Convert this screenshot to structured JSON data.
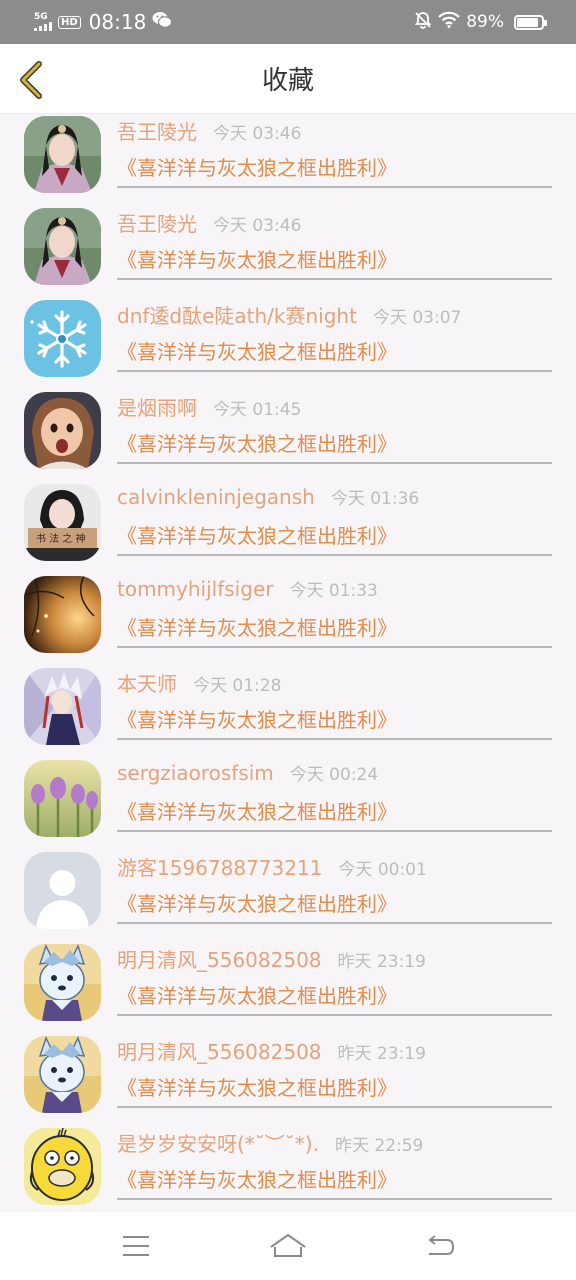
{
  "status_bar": {
    "network": "5G",
    "hd": "HD",
    "time": "08:18",
    "battery": "89%",
    "battery_level": 0.89
  },
  "header": {
    "title": "收藏",
    "back_icon": "chevron-left-icon"
  },
  "colors": {
    "accent": "#e38c4c",
    "name": "#e6a37a",
    "time": "#bdbdbd",
    "back_icon": "#d9b52f"
  },
  "items": [
    {
      "name": "吾王陵光",
      "time": "今天 03:46",
      "title": "《喜洋洋与灰太狼之框出胜利》",
      "avatar": "avatar-costume-man"
    },
    {
      "name": "吾王陵光",
      "time": "今天 03:46",
      "title": "《喜洋洋与灰太狼之框出胜利》",
      "avatar": "avatar-costume-man"
    },
    {
      "name": "dnf逶d酞e陡ath/k赛night",
      "time": "今天 03:07",
      "title": "《喜洋洋与灰太狼之框出胜利》",
      "avatar": "avatar-snowflake"
    },
    {
      "name": "是烟雨啊",
      "time": "今天 01:45",
      "title": "《喜洋洋与灰太狼之框出胜利》",
      "avatar": "avatar-child"
    },
    {
      "name": "calvinkleninjegansh",
      "time": "今天 01:36",
      "title": "《喜洋洋与灰太狼之框出胜利》",
      "avatar": "avatar-woman-sign"
    },
    {
      "name": "tommyhijlfsiger",
      "time": "今天 01:33",
      "title": "《喜洋洋与灰太狼之框出胜利》",
      "avatar": "avatar-sunset"
    },
    {
      "name": "本天师",
      "time": "今天 01:28",
      "title": "《喜洋洋与灰太狼之框出胜利》",
      "avatar": "avatar-anime-master"
    },
    {
      "name": "sergziaorosfsim",
      "time": "今天 00:24",
      "title": "《喜洋洋与灰太狼之框出胜利》",
      "avatar": "avatar-tulips"
    },
    {
      "name": "游客1596788773211",
      "time": "今天 00:01",
      "title": "《喜洋洋与灰太狼之框出胜利》",
      "avatar": "avatar-default-user"
    },
    {
      "name": "明月清风_556082508",
      "time": "昨天 23:19",
      "title": "《喜洋洋与灰太狼之框出胜利》",
      "avatar": "avatar-wolf-cartoon"
    },
    {
      "name": "明月清风_556082508",
      "time": "昨天 23:19",
      "title": "《喜洋洋与灰太狼之框出胜利》",
      "avatar": "avatar-wolf-cartoon"
    },
    {
      "name": "是岁岁安安呀(*˘︶˘*).",
      "time": "昨天 22:59",
      "title": "《喜洋洋与灰太狼之框出胜利》",
      "avatar": "avatar-psyduck"
    }
  ],
  "nav_bar": {
    "menu_icon": "menu-icon",
    "home_icon": "home-icon",
    "back_icon": "back-arrow-icon"
  }
}
